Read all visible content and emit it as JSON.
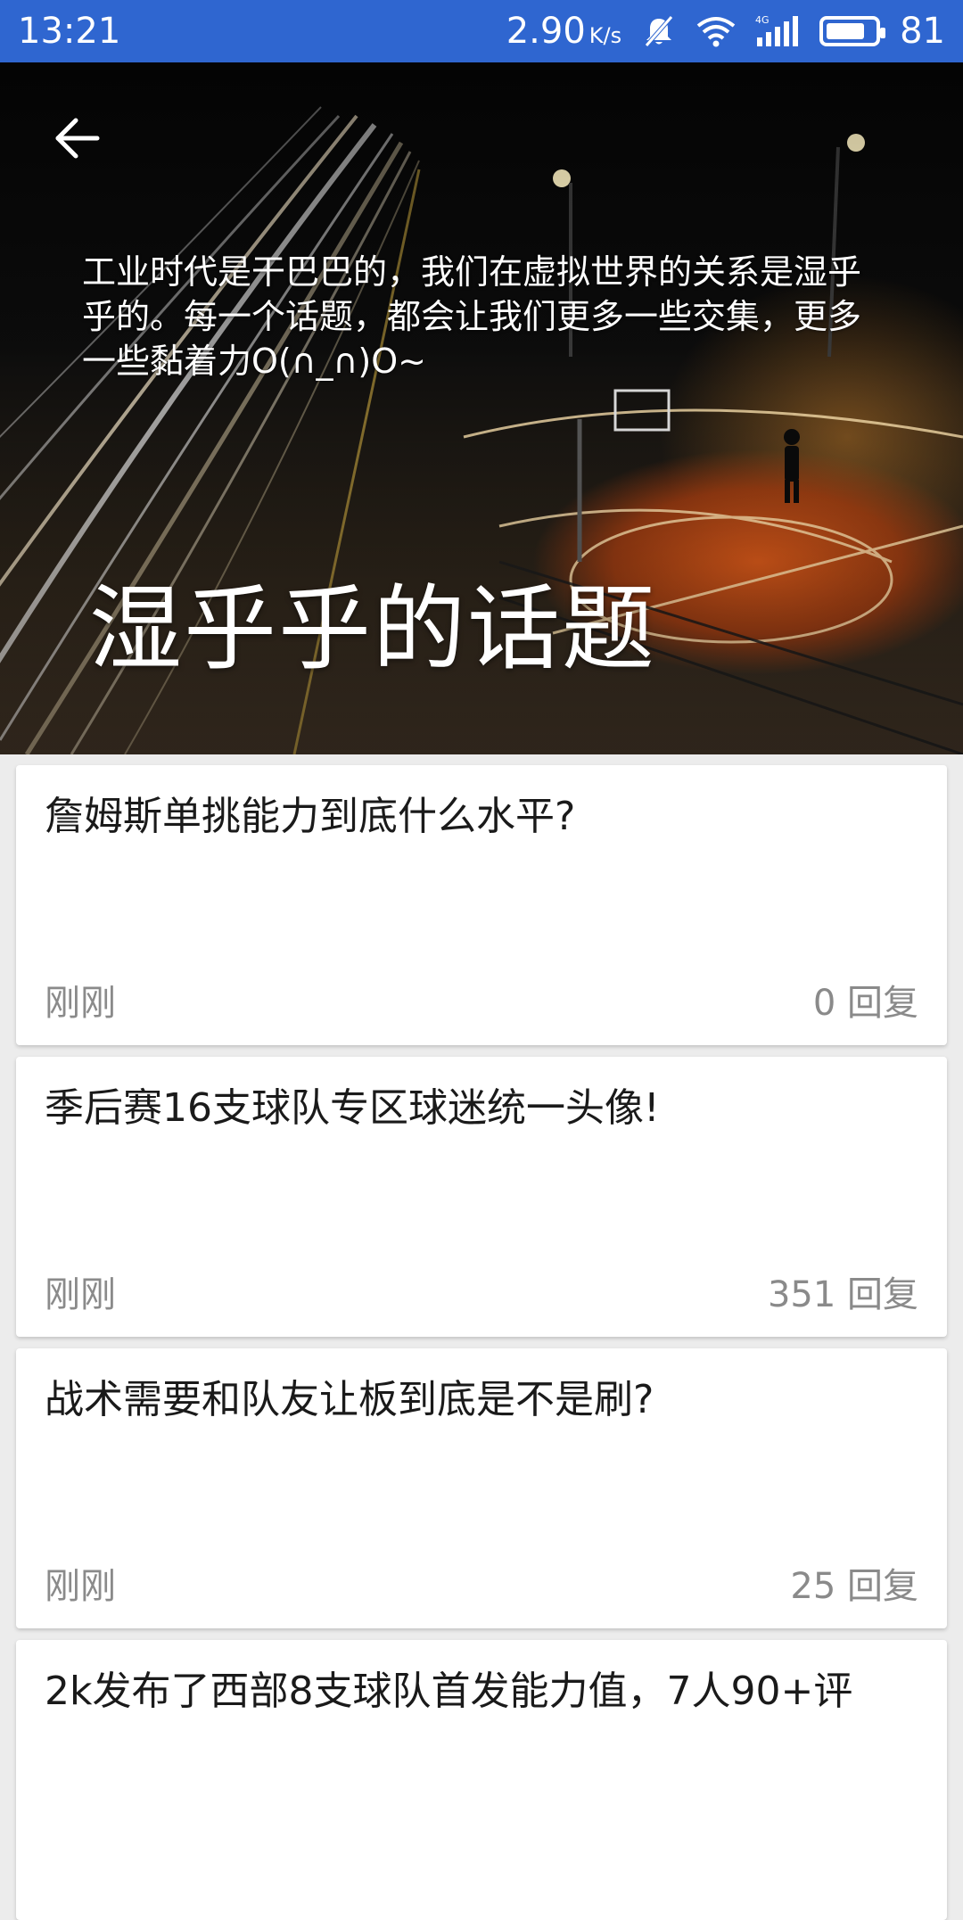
{
  "status_bar": {
    "time": "13:21",
    "speed": "2.90",
    "speed_unit": "K/s",
    "battery": "81",
    "battery_level": 0.81
  },
  "header": {
    "description": "工业时代是干巴巴的，我们在虚拟世界的关系是湿乎乎的。每一个话题，都会让我们更多一些交集，更多一些黏着力O(∩_∩)O~",
    "title": "湿乎乎的话题"
  },
  "topics": [
    {
      "title": "詹姆斯单挑能力到底什么水平?",
      "time": "刚刚",
      "replies": "0 回复"
    },
    {
      "title": "季后赛16支球队专区球迷统一头像!",
      "time": "刚刚",
      "replies": "351 回复"
    },
    {
      "title": "战术需要和队友让板到底是不是刷?",
      "time": "刚刚",
      "replies": "25 回复"
    },
    {
      "title": "2k发布了西部8支球队首发能力值，7人90+评",
      "time": "",
      "replies": ""
    }
  ],
  "colors": {
    "status_bar": "#2f66d0",
    "card_bg": "#ffffff",
    "meta_text": "#8a8a8a"
  }
}
